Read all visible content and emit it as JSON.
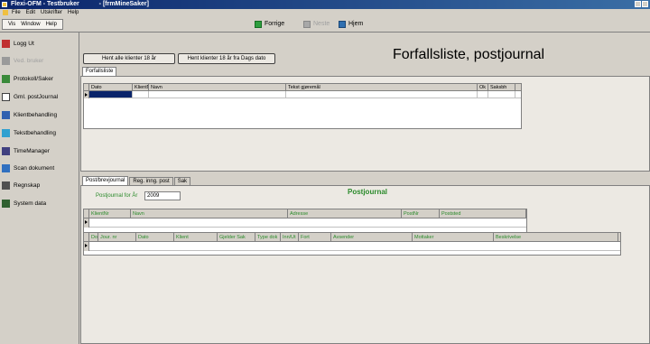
{
  "window": {
    "app_title": "Flexi-OFM - Testbruker",
    "doc_title": "- [frmMineSaker]"
  },
  "menubar": {
    "items": [
      "File",
      "Edit",
      "Utskrifter",
      "Help"
    ]
  },
  "window_menu": {
    "items": [
      "Vis",
      "Window",
      "Help"
    ]
  },
  "toolbar": {
    "forrige_label": "Forrige",
    "neste_label": "Neste",
    "hjem_label": "Hjem"
  },
  "page_heading": "Forfallsliste, postjournal",
  "sidebar": {
    "items": [
      {
        "label": "Logg Ut",
        "icon": "logout-icon",
        "color": "#c03030",
        "disabled": false
      },
      {
        "label": "Ved. bruker",
        "icon": "user-icon",
        "color": "#9a9a9a",
        "disabled": true
      },
      {
        "label": "Protokoll/Saker",
        "icon": "protocol-icon",
        "color": "#3a8a3a",
        "disabled": false
      },
      {
        "label": "Gml. postJournal",
        "icon": "document-icon",
        "color": "#ffffff",
        "disabled": false
      },
      {
        "label": "Klientbehandling",
        "icon": "clients-icon",
        "color": "#3060b0",
        "disabled": false
      },
      {
        "label": "Tekstbehandling",
        "icon": "text-icon",
        "color": "#30a0d0",
        "disabled": false
      },
      {
        "label": "TimeManager",
        "icon": "calendar-icon",
        "color": "#404080",
        "disabled": false
      },
      {
        "label": "Scan dokument",
        "icon": "scanner-icon",
        "color": "#3070c0",
        "disabled": false
      },
      {
        "label": "Regnskap",
        "icon": "ledger-icon",
        "color": "#505050",
        "disabled": false
      },
      {
        "label": "System data",
        "icon": "system-icon",
        "color": "#306030",
        "disabled": false
      }
    ]
  },
  "buttons": {
    "hent_alle": "Hent alle klienter 18 år",
    "hent_fra_dato": "Hent klienter 18 år fra Dags dato"
  },
  "forfall_tab": "Forfallsliste",
  "forfall_grid": {
    "columns": [
      "Dato",
      "KlientNr",
      "Navn",
      "Tekst gjøremål",
      "Ok",
      "Saksbh"
    ]
  },
  "bottom_tabs": [
    "Post/brevjournal",
    "Reg. inng. post",
    "Sak"
  ],
  "postjournal": {
    "title": "Postjournal",
    "year_label": "Postjournal for År",
    "year_value": "2009"
  },
  "client_grid": {
    "columns": [
      "KlientNr",
      "Navn",
      "Adresse",
      "PostNr",
      "Poststed"
    ]
  },
  "doc_grid": {
    "columns": [
      "Doc",
      "Jour. nr",
      "Dato",
      "Klient",
      "Gjelder Sak",
      "Type dok",
      "Inn/Ut",
      "Fort",
      "Avsender",
      "Mottaker",
      "Beskrivelse"
    ]
  }
}
